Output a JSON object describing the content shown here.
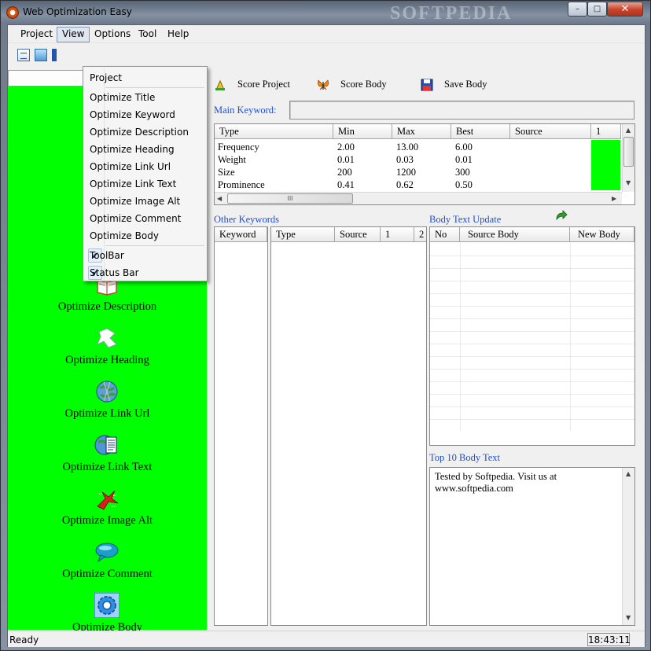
{
  "window": {
    "title": "Web Optimization Easy",
    "watermark": "SOFTPEDIA",
    "controls": {
      "minimize": "–",
      "maximize": "□",
      "close": "✕"
    }
  },
  "menubar": [
    "Project",
    "View",
    "Options",
    "Tool",
    "Help"
  ],
  "view_menu": {
    "items": [
      {
        "label": "Project",
        "checked": false
      },
      {
        "label": "Optimize Title",
        "checked": false
      },
      {
        "label": "Optimize Keyword",
        "checked": false
      },
      {
        "label": "Optimize Description",
        "checked": false
      },
      {
        "label": "Optimize Heading",
        "checked": false
      },
      {
        "label": "Optimize Link Url",
        "checked": false
      },
      {
        "label": "Optimize Link Text",
        "checked": false
      },
      {
        "label": "Optimize Image Alt",
        "checked": false
      },
      {
        "label": "Optimize Comment",
        "checked": false
      },
      {
        "label": "Optimize Body",
        "checked": false
      },
      {
        "label": "ToolBar",
        "checked": true
      },
      {
        "label": "Status Bar",
        "checked": true
      }
    ],
    "check_glyph": "✔"
  },
  "nav": [
    {
      "label": "Optimize Description",
      "icon": "book-icon"
    },
    {
      "label": "Optimize Heading",
      "icon": "heading-icon"
    },
    {
      "label": "Optimize Link Url",
      "icon": "globe-icon"
    },
    {
      "label": "Optimize Link Text",
      "icon": "globe-document-icon"
    },
    {
      "label": "Optimize Image Alt",
      "icon": "image-alt-icon"
    },
    {
      "label": "Optimize Comment",
      "icon": "speech-bubble-icon"
    },
    {
      "label": "Optimize Body",
      "icon": "gear-icon"
    }
  ],
  "actions": {
    "score_project": "Score Project",
    "score_body": "Score Body",
    "save_body": "Save Body"
  },
  "main_keyword": {
    "label": "Main Keyword:",
    "value": ""
  },
  "score_table": {
    "columns": [
      "Type",
      "Min",
      "Max",
      "Best",
      "Source",
      "1"
    ],
    "rows": [
      [
        "Frequency",
        "2.00",
        "13.00",
        "6.00",
        ""
      ],
      [
        "Weight",
        "0.01",
        "0.03",
        "0.01",
        ""
      ],
      [
        "Size",
        "200",
        "1200",
        "300",
        ""
      ],
      [
        "Prominence",
        "0.41",
        "0.62",
        "0.50",
        ""
      ]
    ],
    "hscroll_thumb": "III",
    "highlight_color": "#00ff00"
  },
  "other_keywords": {
    "label": "Other Keywords",
    "keyword_columns": [
      "Keyword"
    ],
    "detail_columns": [
      "Type",
      "Source",
      "1",
      "2"
    ]
  },
  "body_text_update": {
    "label": "Body Text Update",
    "columns": [
      "No",
      "Source Body",
      "New Body"
    ]
  },
  "top10": {
    "label": "Top 10 Body Text",
    "text": "Tested by Softpedia. Visit us at www.softpedia.com"
  },
  "status": {
    "text": "Ready",
    "clock": "18:43:11"
  },
  "colors": {
    "panel_green": "#00ff00",
    "link_blue": "#1f4fd6"
  }
}
